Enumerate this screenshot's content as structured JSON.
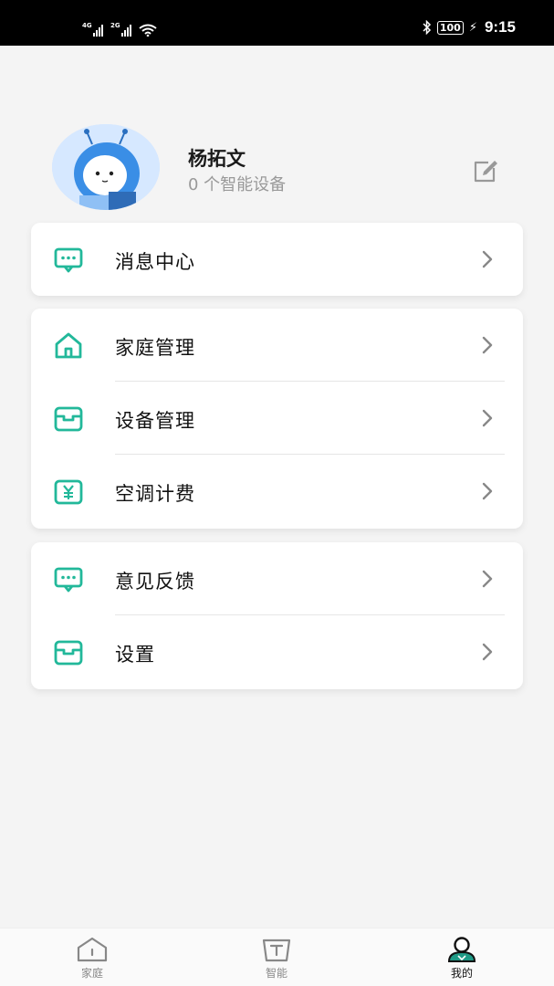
{
  "status_bar": {
    "signal1_label": "4G",
    "signal2_label": "2G",
    "battery": "100",
    "time": "9:15"
  },
  "profile": {
    "name": "杨拓文",
    "device_count": "0 个智能设备"
  },
  "menu_groups": [
    {
      "items": [
        {
          "label": "消息中心",
          "icon": "message-icon"
        }
      ]
    },
    {
      "items": [
        {
          "label": "家庭管理",
          "icon": "home-icon"
        },
        {
          "label": "设备管理",
          "icon": "device-box-icon"
        },
        {
          "label": "空调计费",
          "icon": "yuan-bill-icon"
        }
      ]
    },
    {
      "items": [
        {
          "label": "意见反馈",
          "icon": "feedback-icon"
        },
        {
          "label": "设置",
          "icon": "settings-box-icon"
        }
      ]
    }
  ],
  "tabbar": {
    "tabs": [
      {
        "label": "家庭",
        "icon": "home-tab-icon",
        "active": false
      },
      {
        "label": "智能",
        "icon": "smart-tab-icon",
        "active": false
      },
      {
        "label": "我的",
        "icon": "profile-tab-icon",
        "active": true
      }
    ]
  },
  "colors": {
    "accent": "#22b89a",
    "text_primary": "#111111",
    "text_secondary": "#999999",
    "background": "#f4f4f4"
  }
}
